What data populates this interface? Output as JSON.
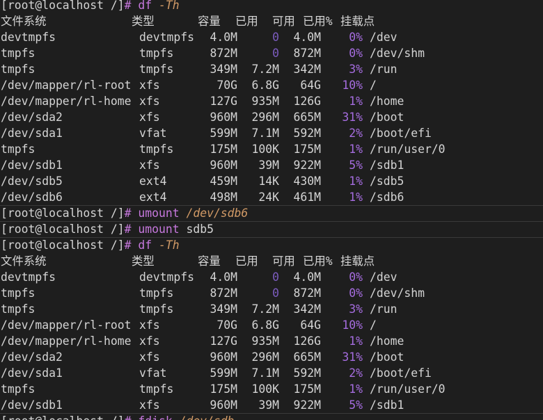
{
  "prompt": "[root@localhost /]",
  "prompt_hash": "#",
  "header_columns": [
    "文件系统",
    "类型",
    "容量",
    "已用",
    "可用",
    "已用%",
    "挂载点"
  ],
  "df_output_1": [
    [
      "devtmpfs",
      "devtmpfs",
      "4.0M",
      "0",
      "4.0M",
      "0%",
      "/dev"
    ],
    [
      "tmpfs",
      "tmpfs",
      "872M",
      "0",
      "872M",
      "0%",
      "/dev/shm"
    ],
    [
      "tmpfs",
      "tmpfs",
      "349M",
      "7.2M",
      "342M",
      "3%",
      "/run"
    ],
    [
      "/dev/mapper/rl-root",
      "xfs",
      "70G",
      "6.8G",
      "64G",
      "10%",
      "/"
    ],
    [
      "/dev/mapper/rl-home",
      "xfs",
      "127G",
      "935M",
      "126G",
      "1%",
      "/home"
    ],
    [
      "/dev/sda2",
      "xfs",
      "960M",
      "296M",
      "665M",
      "31%",
      "/boot"
    ],
    [
      "/dev/sda1",
      "vfat",
      "599M",
      "7.1M",
      "592M",
      "2%",
      "/boot/efi"
    ],
    [
      "tmpfs",
      "tmpfs",
      "175M",
      "100K",
      "175M",
      "1%",
      "/run/user/0"
    ],
    [
      "/dev/sdb1",
      "xfs",
      "960M",
      "39M",
      "922M",
      "5%",
      "/sdb1"
    ],
    [
      "/dev/sdb5",
      "ext4",
      "459M",
      "14K",
      "430M",
      "1%",
      "/sdb5"
    ],
    [
      "/dev/sdb6",
      "ext4",
      "498M",
      "24K",
      "461M",
      "1%",
      "/sdb6"
    ]
  ],
  "df_output_2": [
    [
      "devtmpfs",
      "devtmpfs",
      "4.0M",
      "0",
      "4.0M",
      "0%",
      "/dev"
    ],
    [
      "tmpfs",
      "tmpfs",
      "872M",
      "0",
      "872M",
      "0%",
      "/dev/shm"
    ],
    [
      "tmpfs",
      "tmpfs",
      "349M",
      "7.2M",
      "342M",
      "3%",
      "/run"
    ],
    [
      "/dev/mapper/rl-root",
      "xfs",
      "70G",
      "6.8G",
      "64G",
      "10%",
      "/"
    ],
    [
      "/dev/mapper/rl-home",
      "xfs",
      "127G",
      "935M",
      "126G",
      "1%",
      "/home"
    ],
    [
      "/dev/sda2",
      "xfs",
      "960M",
      "296M",
      "665M",
      "31%",
      "/boot"
    ],
    [
      "/dev/sda1",
      "vfat",
      "599M",
      "7.1M",
      "592M",
      "2%",
      "/boot/efi"
    ],
    [
      "tmpfs",
      "tmpfs",
      "175M",
      "100K",
      "175M",
      "1%",
      "/run/user/0"
    ],
    [
      "/dev/sdb1",
      "xfs",
      "960M",
      "39M",
      "922M",
      "5%",
      "/sdb1"
    ]
  ],
  "commands": [
    {
      "cmd": "df",
      "args": "-Th",
      "args_style": "opt"
    },
    {
      "cmd": "umount",
      "args": "/dev/sdb6",
      "args_style": "opt"
    },
    {
      "cmd": "umount",
      "args": "sdb5",
      "args_style": "plain"
    },
    {
      "cmd": "df",
      "args": "-Th",
      "args_style": "opt"
    },
    {
      "cmd": "fdisk",
      "args": "/dev/sdb",
      "args_style": "opt"
    }
  ],
  "colors": {
    "background": "#1e1e1e",
    "text": "#d4d4d4",
    "command": "#c678dd",
    "option": "#d19a66",
    "zero_value": "#7c5cbf",
    "percent": "#a66de0"
  }
}
